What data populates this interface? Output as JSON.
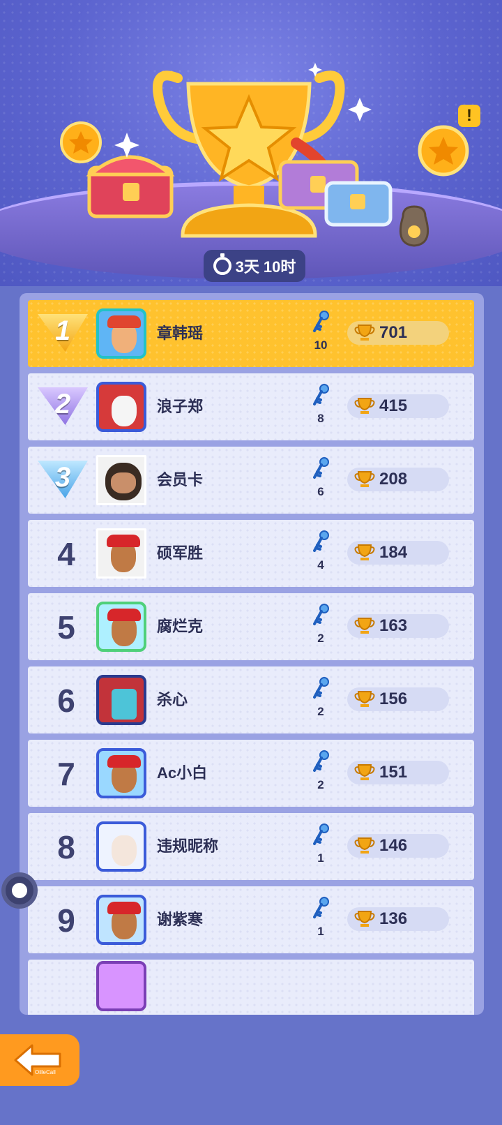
{
  "header": {
    "timer_text": "3天 10时",
    "alert_symbol": "!"
  },
  "leaderboard": [
    {
      "rank": "1",
      "name": "章韩瑶",
      "keys": "10",
      "score": "701"
    },
    {
      "rank": "2",
      "name": "浪子郑",
      "keys": "8",
      "score": "415"
    },
    {
      "rank": "3",
      "name": "会员卡",
      "keys": "6",
      "score": "208"
    },
    {
      "rank": "4",
      "name": "硕军胜",
      "keys": "4",
      "score": "184"
    },
    {
      "rank": "5",
      "name": "腐烂克",
      "keys": "2",
      "score": "163"
    },
    {
      "rank": "6",
      "name": "杀心",
      "keys": "2",
      "score": "156"
    },
    {
      "rank": "7",
      "name": "Ac小白",
      "keys": "2",
      "score": "151"
    },
    {
      "rank": "8",
      "name": "违规昵称",
      "keys": "1",
      "score": "146"
    },
    {
      "rank": "9",
      "name": "谢紫寒",
      "keys": "1",
      "score": "136"
    }
  ],
  "footer": {
    "back_tag": "OilleCall"
  },
  "colors": {
    "background": "#6673c9",
    "first_row": "#ffc22e",
    "row": "#e9ecfb",
    "back_button": "#ff9a1f"
  }
}
